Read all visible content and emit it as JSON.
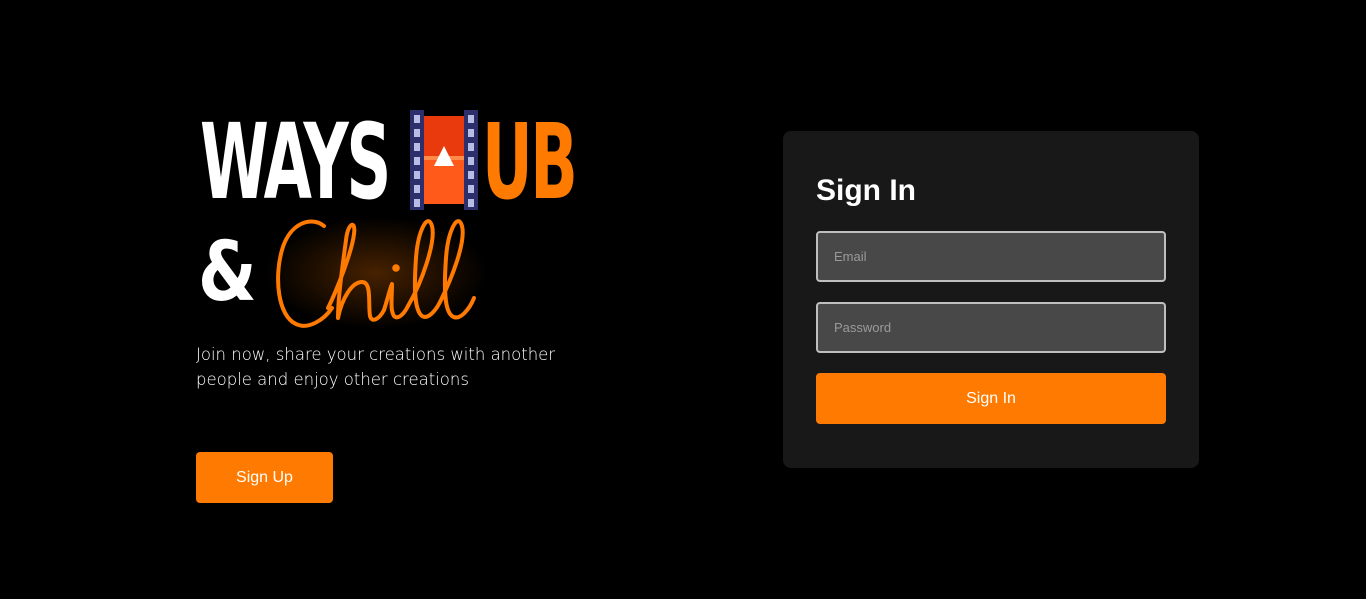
{
  "brand": {
    "word1": "WAYS",
    "word2": "UB",
    "ampersand": "&",
    "script_word": "Chill",
    "icon": "film-play-icon",
    "accent_color": "#ff7a00"
  },
  "hero": {
    "tagline_line1": "Join now, share your creations with another",
    "tagline_line2": "people and enjoy other creations",
    "signup_label": "Sign Up"
  },
  "signin_card": {
    "title": "Sign In",
    "email_placeholder": "Email",
    "password_placeholder": "Password",
    "submit_label": "Sign In"
  },
  "colors": {
    "background": "#000000",
    "card": "#181818",
    "input_bg": "#484848",
    "input_border": "#bfbfbf",
    "accent": "#ff7a00"
  }
}
